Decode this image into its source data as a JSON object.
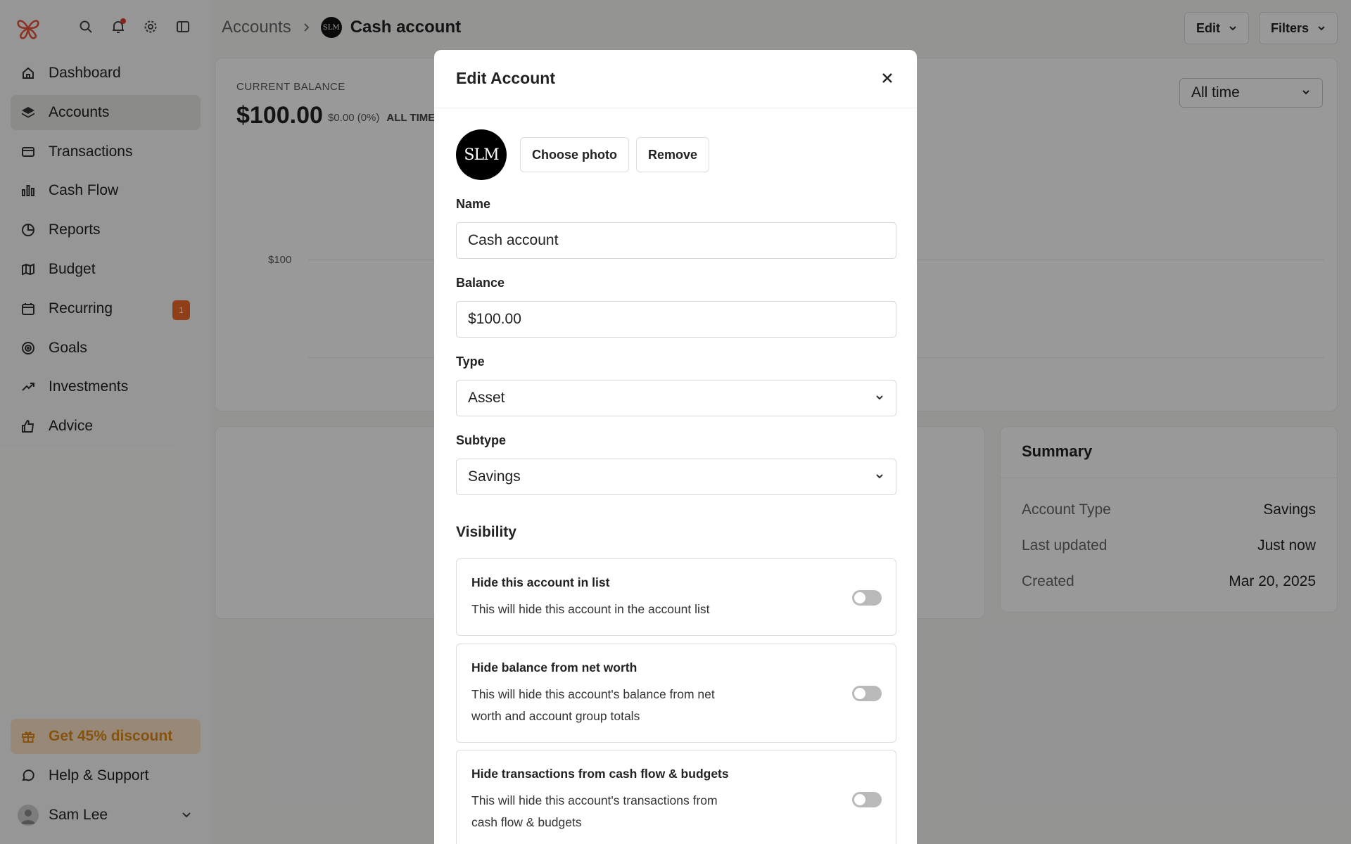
{
  "sidebar": {
    "items": [
      {
        "label": "Dashboard",
        "icon": "home-icon"
      },
      {
        "label": "Accounts",
        "icon": "layers-icon",
        "active": true
      },
      {
        "label": "Transactions",
        "icon": "credit-card-icon"
      },
      {
        "label": "Cash Flow",
        "icon": "bar-chart-icon"
      },
      {
        "label": "Reports",
        "icon": "pie-chart-icon"
      },
      {
        "label": "Budget",
        "icon": "map-icon"
      },
      {
        "label": "Recurring",
        "icon": "calendar-icon",
        "badge": "1"
      },
      {
        "label": "Goals",
        "icon": "target-icon"
      },
      {
        "label": "Investments",
        "icon": "trending-up-icon"
      },
      {
        "label": "Advice",
        "icon": "thumbs-up-icon"
      }
    ],
    "discount": "Get 45% discount",
    "help": "Help & Support",
    "user": "Sam Lee"
  },
  "header": {
    "crumb_parent": "Accounts",
    "account_avatar": "SLM",
    "crumb_current": "Cash account",
    "edit_label": "Edit",
    "filters_label": "Filters"
  },
  "balance": {
    "label": "CURRENT BALANCE",
    "value": "$100.00",
    "change": "$0.00 (0%)",
    "change_period": "ALL TIME",
    "range": "All time",
    "ytick": "$100"
  },
  "summary": {
    "title": "Summary",
    "rows": [
      {
        "k": "Account Type",
        "v": "Savings"
      },
      {
        "k": "Last updated",
        "v": "Just now"
      },
      {
        "k": "Created",
        "v": "Mar 20, 2025"
      }
    ]
  },
  "modal": {
    "title": "Edit Account",
    "avatar_text": "SLM",
    "choose_photo": "Choose photo",
    "remove": "Remove",
    "name_label": "Name",
    "name_value": "Cash account",
    "balance_label": "Balance",
    "balance_value": "$100.00",
    "type_label": "Type",
    "type_value": "Asset",
    "subtype_label": "Subtype",
    "subtype_value": "Savings",
    "visibility_title": "Visibility",
    "visibility": [
      {
        "title": "Hide this account in list",
        "desc": "This will hide this account in the account list",
        "on": false
      },
      {
        "title": "Hide balance from net worth",
        "desc": "This will hide this account's balance from net worth and account group totals",
        "on": false
      },
      {
        "title": "Hide transactions from cash flow & budgets",
        "desc": "This will hide this account's transactions from cash flow & budgets",
        "on": false
      }
    ]
  },
  "colors": {
    "accent": "#f06a2a",
    "discount": "#e08a1a",
    "logo": "#e8553d"
  }
}
